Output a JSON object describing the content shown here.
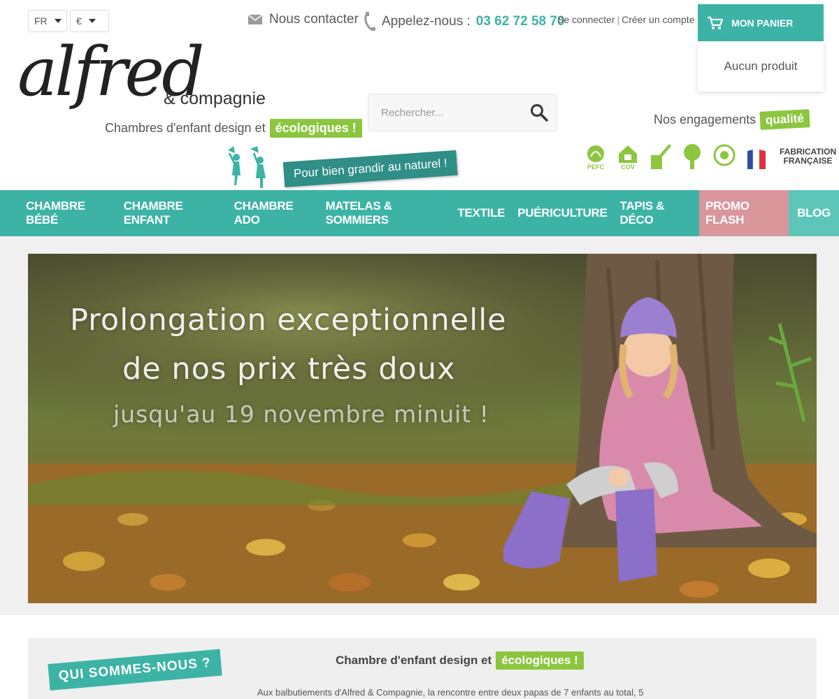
{
  "topbar": {
    "lang": "FR",
    "currency": "€",
    "contact_label": "Nous contacter",
    "phone_label": "Appelez-nous :",
    "phone_number": "03 62 72 58 70",
    "login": "Se connecter",
    "separator": "|",
    "register": "Créer un compte"
  },
  "cart": {
    "label": "MON PANIER",
    "empty": "Aucun produit"
  },
  "logo": {
    "script": "alfred",
    "company": "& compagnie",
    "tagline_prefix": "Chambres d'enfant design et",
    "tagline_badge": "écologiques !",
    "slogan": "Pour bien grandir au naturel !"
  },
  "search": {
    "placeholder": "Rechercher..."
  },
  "engagements": {
    "label": "Nos engagements",
    "badge": "qualité",
    "certs": [
      "PEFC",
      "COV"
    ],
    "fabrication_line1": "FABRICATION",
    "fabrication_line2": "FRANÇAISE"
  },
  "nav": {
    "items": [
      {
        "label": "CHAMBRE BÉBÉ"
      },
      {
        "label": "CHAMBRE ENFANT"
      },
      {
        "label": "CHAMBRE ADO"
      },
      {
        "label": "MATELAS & SOMMIERS"
      },
      {
        "label": "TEXTILE"
      },
      {
        "label": "PUÉRICULTURE"
      },
      {
        "label": "TAPIS & DÉCO"
      }
    ],
    "promo": "PROMO FLASH",
    "blog": "BLOG"
  },
  "hero": {
    "line1": "Prolongation exceptionnelle",
    "line2": "de nos prix très doux",
    "line3": "jusqu'au 19 novembre minuit !"
  },
  "about": {
    "ribbon": "QUI SOMMES-NOUS ?",
    "title_prefix": "Chambre d'enfant design et",
    "title_badge": "écologiques !",
    "text": "Aux balbutiements d'Alfred & Compagnie, la rencontre entre deux papas de 7 enfants au total, 5"
  },
  "colors": {
    "accent": "#3db3a6",
    "green": "#8cc63f",
    "promo": "#d9969b"
  }
}
